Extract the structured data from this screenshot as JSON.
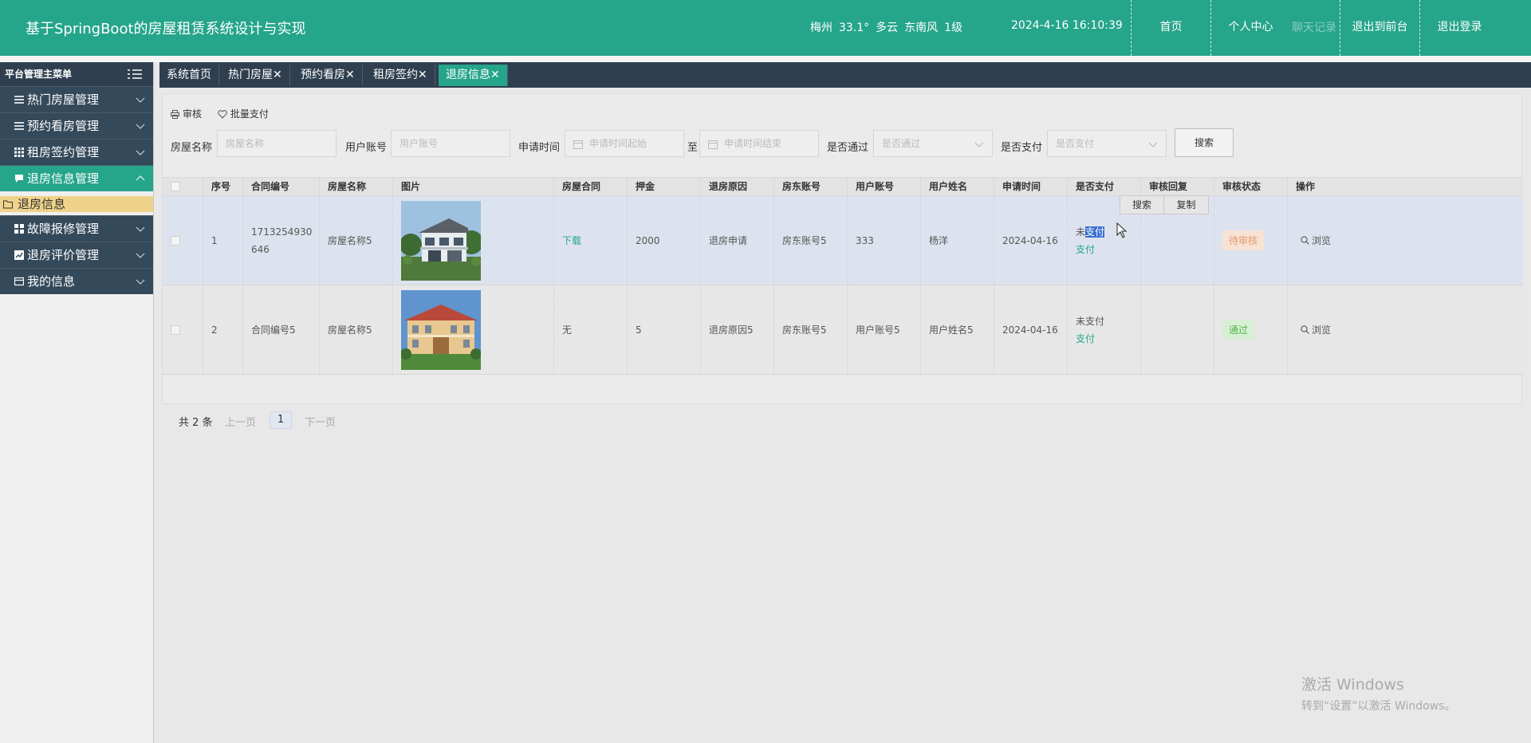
{
  "header": {
    "title": "基于SpringBoot的房屋租赁系统设计与实现",
    "weather": {
      "city": "梅州",
      "temp": "33.1°",
      "sky": "多云",
      "wind": "东南风",
      "level": "1级"
    },
    "datetime": "2024-4-16 16:10:39",
    "nav": [
      "首页",
      "个人中心",
      "退出到前台",
      "退出登录"
    ],
    "faded_item": "聊天记录"
  },
  "sidebar": {
    "title": "平台管理主菜单",
    "items": [
      {
        "label": "热门房屋管理",
        "icon": "list-icon"
      },
      {
        "label": "预约看房管理",
        "icon": "list-icon"
      },
      {
        "label": "租房签约管理",
        "icon": "grid-icon"
      },
      {
        "label": "退房信息管理",
        "icon": "chat-icon",
        "active": true
      },
      {
        "label": "故障报修管理",
        "icon": "apps-icon"
      },
      {
        "label": "退房评价管理",
        "icon": "chart-icon"
      },
      {
        "label": "我的信息",
        "icon": "card-icon"
      }
    ],
    "sub_item": "退房信息"
  },
  "tabs": [
    {
      "label": "系统首页",
      "closable": false
    },
    {
      "label": "热门房屋",
      "closable": true
    },
    {
      "label": "预约看房",
      "closable": true
    },
    {
      "label": "租房签约",
      "closable": true
    },
    {
      "label": "退房信息",
      "closable": true,
      "active": true
    }
  ],
  "toolbar": {
    "audit": "审核",
    "batch_pay": "批量支付"
  },
  "filters": {
    "house_name_label": "房屋名称",
    "house_name_placeholder": "房屋名称",
    "account_label": "用户账号",
    "account_placeholder": "用户账号",
    "time_label": "申请时间",
    "time_start_placeholder": "申请时间起始",
    "time_sep": "至",
    "time_end_placeholder": "申请时间结束",
    "passed_label": "是否通过",
    "passed_placeholder": "是否通过",
    "paid_label": "是否支付",
    "paid_placeholder": "是否支付",
    "search_button": "搜索"
  },
  "table": {
    "headers": [
      "序号",
      "合同编号",
      "房屋名称",
      "图片",
      "房屋合同",
      "押金",
      "退房原因",
      "房东账号",
      "用户账号",
      "用户姓名",
      "申请时间",
      "是否支付",
      "审核回复",
      "审核状态",
      "操作"
    ],
    "rows": [
      {
        "index": "1",
        "contract_no_1": "1713254930",
        "contract_no_2": "646",
        "house_name": "房屋名称5",
        "contract": "下载",
        "deposit": "2000",
        "reason": "退房申请",
        "landlord": "房东账号5",
        "account": "333",
        "name": "杨洋",
        "apply_time": "2024-04-16",
        "paid_pre": "未",
        "paid_sel": "支付",
        "pay_action": "支付",
        "reply": "",
        "status": "待审核",
        "op": "浏览"
      },
      {
        "index": "2",
        "contract_no_1": "合同编号5",
        "contract_no_2": "",
        "house_name": "房屋名称5",
        "contract": "无",
        "deposit": "5",
        "reason": "退房原因5",
        "landlord": "房东账号5",
        "account": "用户账号5",
        "name": "用户姓名5",
        "apply_time": "2024-04-16",
        "paid_pre": "未支付",
        "paid_sel": "",
        "pay_action": "支付",
        "reply": "",
        "status": "通过",
        "op": "浏览"
      }
    ]
  },
  "context_menu": [
    "搜索",
    "复制"
  ],
  "pager": {
    "total": "共 2 条",
    "prev": "上一页",
    "page": "1",
    "next": "下一页"
  },
  "watermark": {
    "line1": "激活 Windows",
    "line2": "转到“设置”以激活 Windows。"
  },
  "colors": {
    "primary": "#25a589",
    "nav_dark": "#2f3f4f",
    "pending": "#e69a6b",
    "pass": "#55b649"
  }
}
